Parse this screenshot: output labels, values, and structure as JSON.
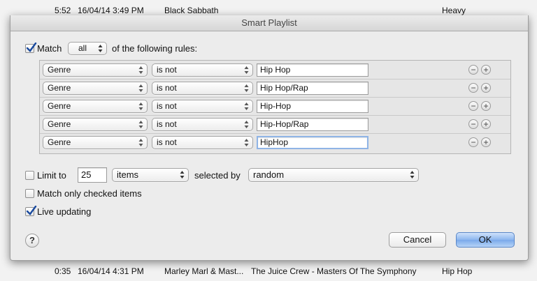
{
  "background_list": {
    "top_row": {
      "time": "5:52",
      "date": "16/04/14 3:49 PM",
      "artist": "Black Sabbath",
      "album": "",
      "genre": "Heavy"
    },
    "bottom_row": {
      "time": "0:35",
      "date": "16/04/14 4:31 PM",
      "artist": "Marley Marl & Mast...",
      "album": "The Juice Crew - Masters Of The Symphony",
      "genre": "Hip Hop"
    }
  },
  "dialog": {
    "title": "Smart Playlist",
    "match": {
      "checked": true,
      "label": "Match",
      "mode": "all",
      "suffix": "of the following rules:"
    },
    "rules": [
      {
        "field": "Genre",
        "operator": "is not",
        "value": "Hip Hop"
      },
      {
        "field": "Genre",
        "operator": "is not",
        "value": "Hip Hop/Rap"
      },
      {
        "field": "Genre",
        "operator": "is not",
        "value": "Hip-Hop"
      },
      {
        "field": "Genre",
        "operator": "is not",
        "value": "Hip-Hop/Rap"
      },
      {
        "field": "Genre",
        "operator": "is not",
        "value": "HipHop"
      }
    ],
    "rule_buttons": {
      "remove": "−",
      "add": "+"
    },
    "limit": {
      "checked": false,
      "label": "Limit to",
      "value": "25",
      "unit": "items",
      "selected_by_label": "selected by",
      "selected_by": "random"
    },
    "match_checked_only": {
      "checked": false,
      "label": "Match only checked items"
    },
    "live_updating": {
      "checked": true,
      "label": "Live updating"
    },
    "help_label": "?",
    "cancel_label": "Cancel",
    "ok_label": "OK"
  },
  "colors": {
    "accent": "#7aa9ea",
    "check": "#1a4a9e"
  }
}
